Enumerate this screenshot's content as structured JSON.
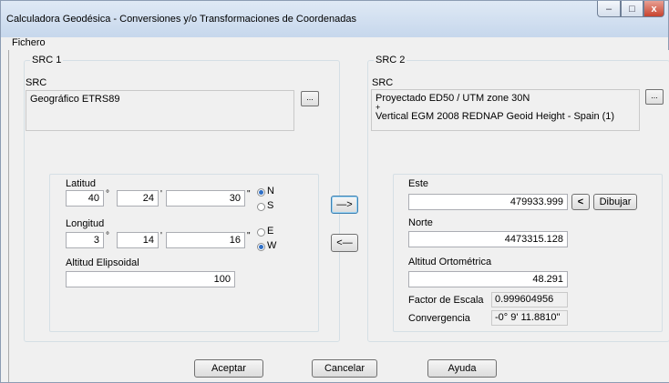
{
  "window": {
    "title": "Calculadora Geodésica - Conversiones y/o Transformaciones de Coordenadas",
    "minimize": "–",
    "maximize": "□",
    "close": "x"
  },
  "menu": {
    "fichero": "Fichero"
  },
  "src1": {
    "group_label": "SRC 1",
    "src_label": "SRC",
    "src_value": "Geográfico ETRS89",
    "browse_label": "...",
    "latitud_label": "Latitud",
    "lat_deg": "40",
    "lat_min": "24",
    "lat_sec": "30",
    "lat_n": "N",
    "lat_s": "S",
    "longitud_label": "Longitud",
    "lon_deg": "3",
    "lon_min": "14",
    "lon_sec": "16",
    "lon_e": "E",
    "lon_w": "W",
    "altitud_label": "Altitud Elipsoidal",
    "altitud_value": "100",
    "deg_sym": "°",
    "min_sym": "'",
    "sec_sym": "\""
  },
  "transfer": {
    "forward": "—>",
    "backward": "<—"
  },
  "src2": {
    "group_label": "SRC 2",
    "src_label": "SRC",
    "src_line1": "Proyectado ED50 / UTM zone 30N",
    "src_line2": "+",
    "src_line3": "Vertical EGM 2008 REDNAP Geoid Height - Spain (1)",
    "browse_label": "...",
    "este_label": "Este",
    "este_value": "479933.999",
    "prev_label": "<",
    "dibujar_label": "Dibujar",
    "norte_label": "Norte",
    "norte_value": "4473315.128",
    "altitud_label": "Altitud Ortométrica",
    "altitud_value": "48.291",
    "factor_label": "Factor de Escala",
    "factor_value": "0.999604956",
    "conv_label": "Convergencia",
    "conv_value": "-0° 9' 11.8810''"
  },
  "buttons": {
    "aceptar": "Aceptar",
    "cancelar": "Cancelar",
    "ayuda": "Ayuda"
  }
}
